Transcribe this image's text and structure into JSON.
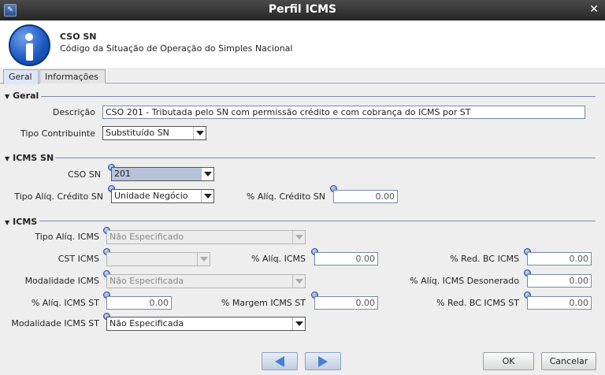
{
  "window": {
    "title": "Perfil ICMS"
  },
  "header": {
    "title": "CSO SN",
    "subtitle": "Código da Situação de Operação do Simples Nacional"
  },
  "tabs": [
    {
      "label": "Geral",
      "active": true
    },
    {
      "label": "Informações",
      "active": false
    }
  ],
  "geral": {
    "section": "Geral",
    "descricao": {
      "label": "Descrição",
      "value": "CSO 201 - Tributada pelo SN com permissão crédito e com cobrança do ICMS por ST"
    },
    "tipo_contribuinte": {
      "label": "Tipo Contribuinte",
      "value": "Substituído SN"
    }
  },
  "icms_sn": {
    "section": "ICMS SN",
    "cso_sn": {
      "label": "CSO SN",
      "value": "201"
    },
    "tipo_aliq_credito": {
      "label": "Tipo Alíq. Crédito SN",
      "value": "Unidade Negócio"
    },
    "aliq_credito": {
      "label": "% Alíq. Crédito SN",
      "value": "0.00"
    }
  },
  "icms": {
    "section": "ICMS",
    "tipo_aliq": {
      "label": "Tipo Alíq. ICMS",
      "value": "Não Especificado"
    },
    "cst": {
      "label": "CST ICMS",
      "value": ""
    },
    "aliq": {
      "label": "% Alíq. ICMS",
      "value": "0.00"
    },
    "red_bc": {
      "label": "% Red. BC ICMS",
      "value": "0.00"
    },
    "modalidade": {
      "label": "Modalidade ICMS",
      "value": "Não Especificada"
    },
    "aliq_desonerado": {
      "label": "% Alíq. ICMS Desonerado",
      "value": "0.00"
    },
    "aliq_st": {
      "label": "% Alíq. ICMS ST",
      "value": "0.00"
    },
    "margem_st": {
      "label": "% Margem ICMS ST",
      "value": "0.00"
    },
    "red_bc_st": {
      "label": "% Red. BC ICMS ST",
      "value": "0.00"
    },
    "modalidade_st": {
      "label": "Modalidade ICMS ST",
      "value": "Não Especificada"
    }
  },
  "footer": {
    "ok_label": "OK",
    "cancel_label": "Cancelar"
  },
  "icons": {
    "app": "app-icon",
    "close": "close-icon",
    "info": "info-icon",
    "prev": "arrow-left-icon",
    "next": "arrow-right-icon",
    "field_marker": "required-dot-icon"
  },
  "colors": {
    "titlebar": "#2f2f2f",
    "info_blue": "#1a56c0",
    "selected_combo": "#b8c3d9",
    "nav_arrow": "#4a7fd0"
  }
}
